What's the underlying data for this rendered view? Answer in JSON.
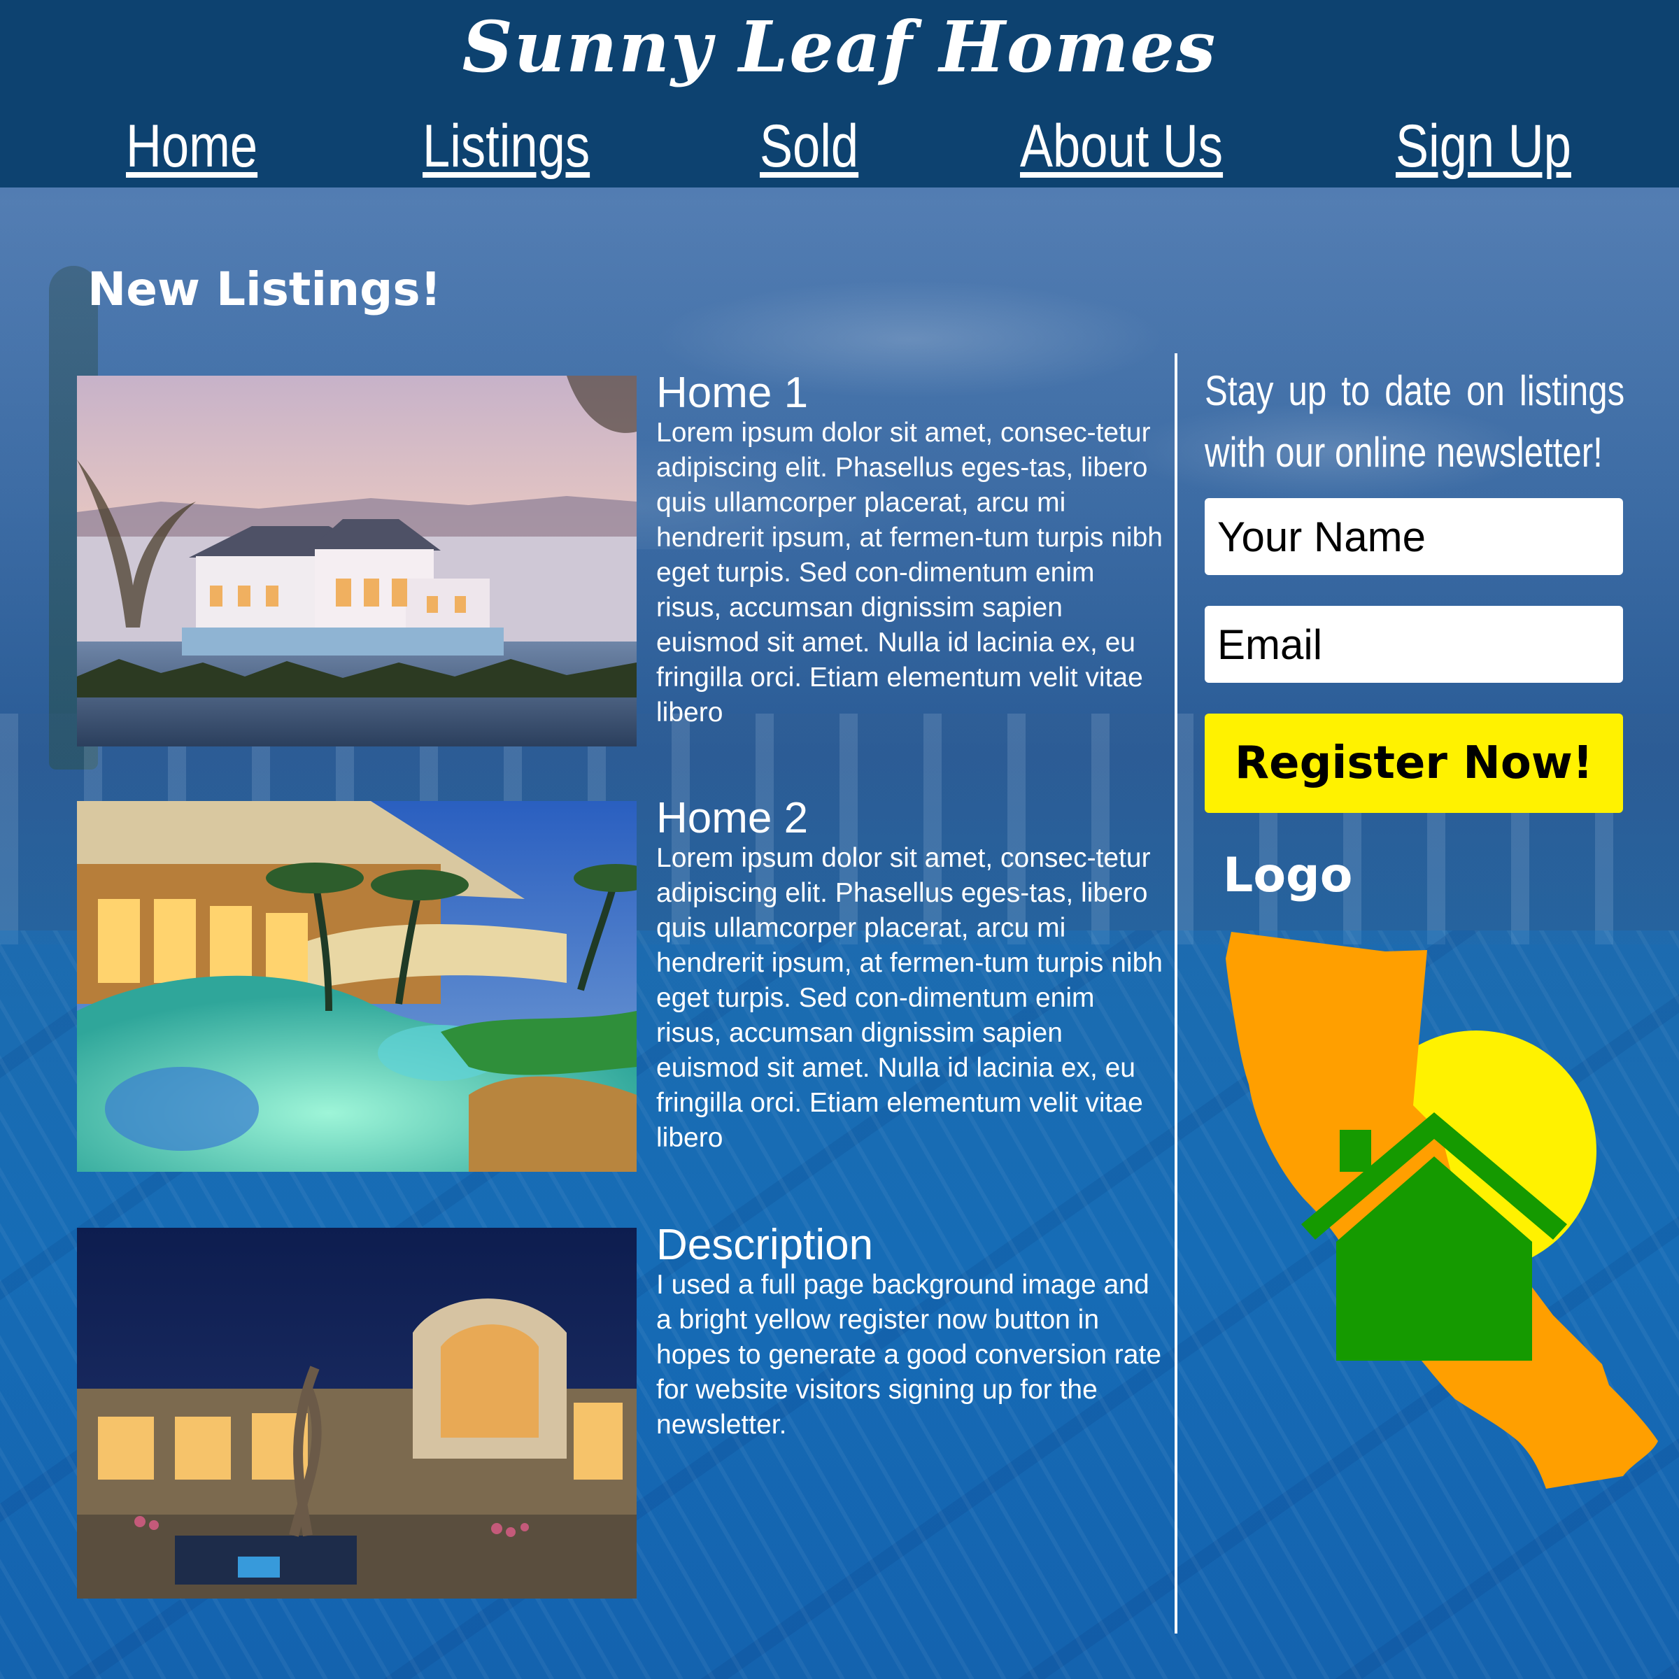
{
  "header": {
    "site_title": "Sunny Leaf Homes",
    "nav": [
      "Home",
      "Listings",
      "Sold",
      "About Us",
      "Sign Up"
    ]
  },
  "main": {
    "section_title": "New Listings!",
    "listings": [
      {
        "title": "Home 1",
        "body": "Lorem ipsum dolor sit amet, consec-tetur adipiscing elit. Phasellus eges-tas, libero quis ullamcorper placerat, arcu mi hendrerit ipsum, at fermen-tum turpis nibh eget turpis. Sed con-dimentum enim risus, accumsan dignissim sapien euismod sit amet. Nulla id lacinia ex, eu fringilla orci. Etiam elementum velit vitae libero"
      },
      {
        "title": "Home 2",
        "body": "Lorem ipsum dolor sit amet, consec-tetur adipiscing elit. Phasellus eges-tas, libero quis ullamcorper placerat, arcu mi hendrerit ipsum, at fermen-tum turpis nibh eget turpis. Sed con-dimentum enim risus, accumsan dignissim sapien euismod sit amet. Nulla id lacinia ex, eu fringilla orci. Etiam elementum velit vitae libero"
      },
      {
        "title": "Description",
        "body": "I used a full page background image and a bright yellow register now button in hopes to generate a good conversion rate for website visitors signing up for the newsletter."
      }
    ]
  },
  "sidebar": {
    "newsletter_text": "Stay up to date on listings with our online newsletter!",
    "name_placeholder": "Your Name",
    "email_placeholder": "Email",
    "register_label": "Register Now!",
    "logo_label": "Logo"
  },
  "colors": {
    "header_bg": "#0d4270",
    "register_button": "#fff200",
    "logo_state": "#ff9f00",
    "logo_sun": "#fff200",
    "logo_house": "#159a00",
    "text": "#ffffff"
  },
  "icons": {
    "logo": "california-house-logo",
    "photos": [
      "mansion-waterfront-photo",
      "resort-pool-house-photo",
      "modern-villa-night-photo"
    ]
  }
}
